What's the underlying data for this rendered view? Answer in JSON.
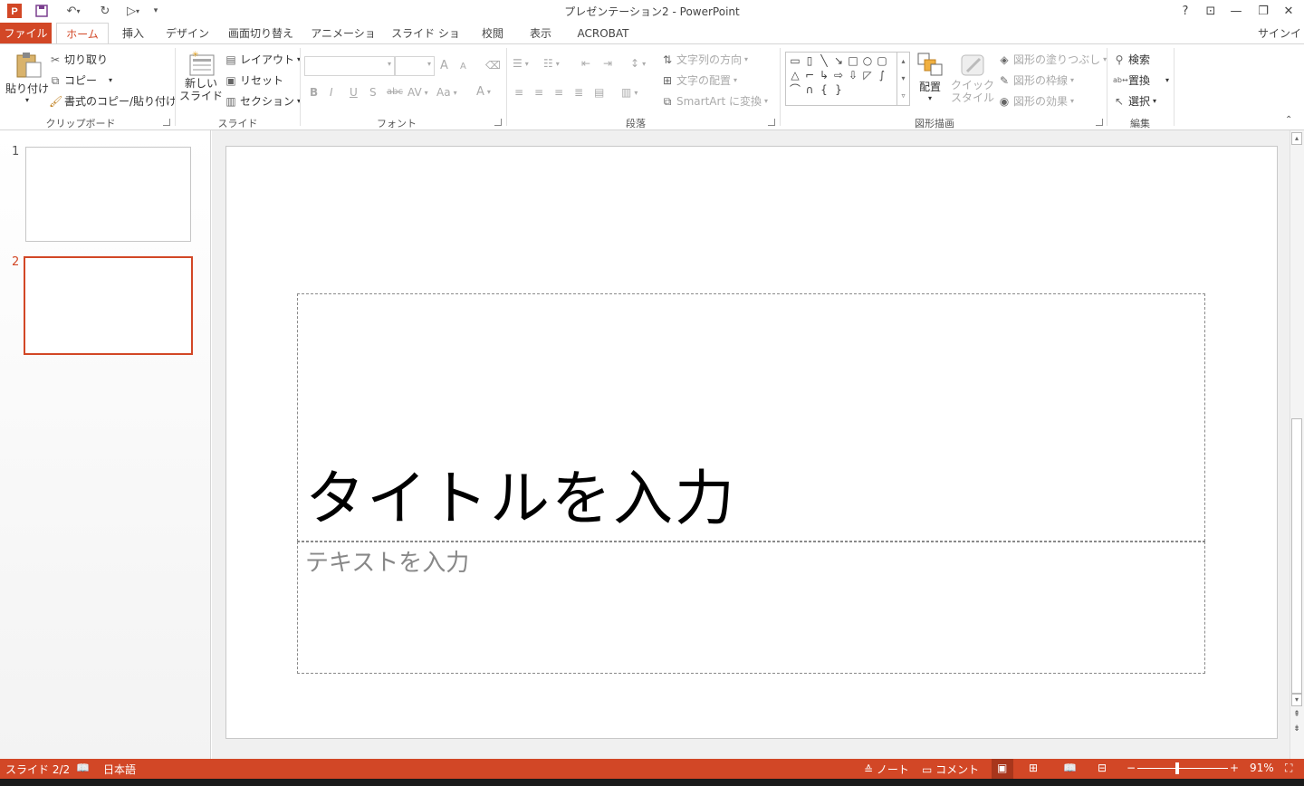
{
  "window": {
    "title": "プレゼンテーション2 - PowerPoint",
    "help": "?",
    "sign_in": "サインイン"
  },
  "tabs": [
    {
      "label": "ファイル"
    },
    {
      "label": "ホーム"
    },
    {
      "label": "挿入"
    },
    {
      "label": "デザイン"
    },
    {
      "label": "画面切り替え"
    },
    {
      "label": "アニメーション"
    },
    {
      "label": "スライド ショー"
    },
    {
      "label": "校閲"
    },
    {
      "label": "表示"
    },
    {
      "label": "ACROBAT"
    }
  ],
  "ribbon": {
    "clipboard": {
      "paste": "貼り付け",
      "cut": "切り取り",
      "copy": "コピー",
      "format_painter": "書式のコピー/貼り付け",
      "label": "クリップボード"
    },
    "slides": {
      "new_slide_1": "新しい",
      "new_slide_2": "スライド",
      "layout": "レイアウト",
      "reset": "リセット",
      "section": "セクション",
      "label": "スライド"
    },
    "font": {
      "bold": "B",
      "italic": "I",
      "underline": "U",
      "shadow": "S",
      "strike": "abc",
      "spacing": "AV",
      "case": "Aa",
      "color": "A",
      "grow": "A",
      "shrink": "A",
      "label": "フォント"
    },
    "paragraph": {
      "text_direction": "文字列の方向",
      "align_text": "文字の配置",
      "smartart": "SmartArt に変換",
      "label": "段落"
    },
    "drawing": {
      "arrange": "配置",
      "quick_styles_1": "クイック",
      "quick_styles_2": "スタイル",
      "shape_fill": "図形の塗りつぶし",
      "shape_outline": "図形の枠線",
      "shape_effects": "図形の効果",
      "label": "図形描画"
    },
    "editing": {
      "find": "検索",
      "replace": "置換",
      "select": "選択",
      "label": "編集"
    }
  },
  "thumbnails": [
    {
      "number": "1"
    },
    {
      "number": "2"
    }
  ],
  "slide": {
    "title_placeholder": "タイトルを入力",
    "subtitle_placeholder": "テキストを入力"
  },
  "status": {
    "slide_info": "スライド 2/2",
    "language": "日本語",
    "notes": "ノート",
    "comments": "コメント",
    "zoom": "91%"
  },
  "colors": {
    "accent": "#d24726"
  }
}
